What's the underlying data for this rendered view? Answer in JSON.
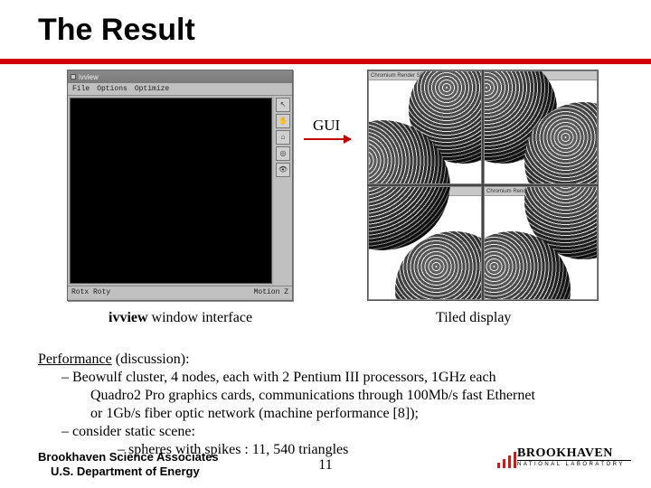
{
  "title": "The Result",
  "gui_label": "GUI",
  "ivview": {
    "window_title": "ivview",
    "menu": [
      "File",
      "Options",
      "Optimize"
    ],
    "status_left": "Rotx   Roty",
    "status_right": "Motion  Z",
    "caption_bold": "ivview",
    "caption_rest": " window interface"
  },
  "tiled": {
    "tile_title": "Chromium Render SPU",
    "caption": "Tiled display"
  },
  "performance": {
    "heading": "Performance",
    "heading_rest": " (discussion):",
    "line1": "– Beowulf cluster, 4 nodes, each with 2 Pentium III processors, 1GHz each",
    "line2": "Quadro2 Pro graphics cards, communications through 100Mb/s fast Ethernet",
    "line3": " or 1Gb/s fiber optic network (machine performance [8]);",
    "line4": "– consider static scene:",
    "line5": "– spheres with spikes : 11, 540 triangles"
  },
  "footer": {
    "assoc_line1": "Brookhaven Science Associates",
    "assoc_line2": "U.S. Department of Energy",
    "page_number": "11",
    "logo_main": "BROOKHAVEN",
    "logo_sub": "NATIONAL LABORATORY"
  }
}
